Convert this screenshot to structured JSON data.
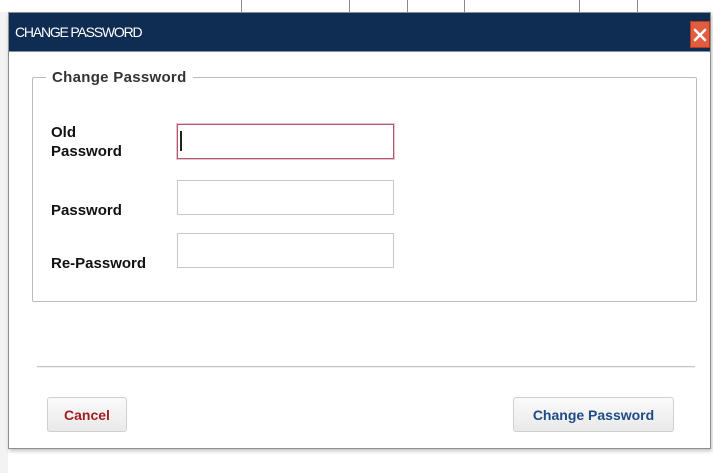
{
  "dialog": {
    "title": "CHANGE PASSWORD",
    "close_icon": "close-icon"
  },
  "form": {
    "legend": "Change Password",
    "fields": [
      {
        "label": "Old Password",
        "value": ""
      },
      {
        "label": "Password",
        "value": ""
      },
      {
        "label": "Re-Password",
        "value": ""
      }
    ]
  },
  "actions": {
    "cancel_label": "Cancel",
    "submit_label": "Change Password"
  },
  "colors": {
    "titlebar": "#0f2c53",
    "close_button": "#e25d3e",
    "cancel_text": "#a01f1f",
    "submit_text": "#1f4b86"
  }
}
